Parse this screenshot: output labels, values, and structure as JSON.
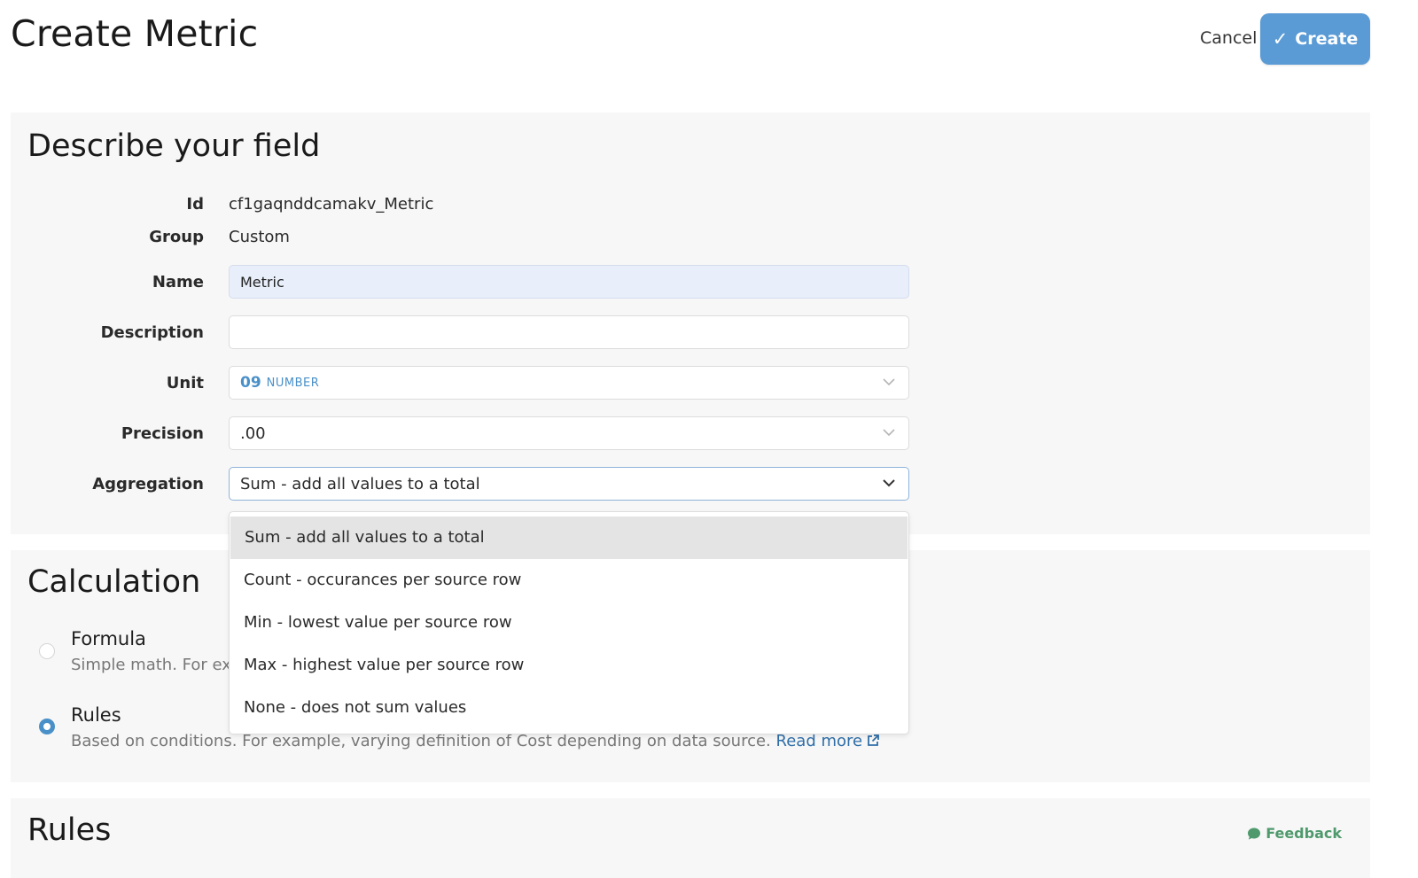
{
  "header": {
    "title": "Create Metric",
    "cancel_label": "Cancel",
    "create_label": "Create"
  },
  "describe": {
    "title": "Describe your field",
    "id_label": "Id",
    "id_value": "cf1gaqnddcamakv_Metric",
    "group_label": "Group",
    "group_value": "Custom",
    "name_label": "Name",
    "name_value": "Metric",
    "description_label": "Description",
    "description_value": "",
    "unit_label": "Unit",
    "unit_code": "09",
    "unit_name": "NUMBER",
    "precision_label": "Precision",
    "precision_value": ".00",
    "aggregation_label": "Aggregation",
    "aggregation_value": "Sum - add all values to a total",
    "aggregation_options": [
      "Sum - add all values to a total",
      "Count - occurances per source row",
      "Min - lowest value per source row",
      "Max - highest value per source row",
      "None - does not sum values"
    ]
  },
  "calculation": {
    "title": "Calculation",
    "formula_title": "Formula",
    "formula_desc": "Simple math. For exa",
    "rules_title": "Rules",
    "rules_desc": "Based on conditions. For example, varying definition of Cost depending on data source.",
    "read_more": "Read more",
    "selected": "Rules"
  },
  "rules": {
    "title": "Rules",
    "feedback_label": "Feedback"
  },
  "colors": {
    "primary": "#5b9bd5",
    "link": "#2f6ea8",
    "feedback": "#4f9a6d",
    "panel_bg": "#f7f7f7"
  },
  "icons": [
    "check-icon",
    "chevron-down-icon",
    "external-link-icon",
    "speech-bubble-icon"
  ]
}
